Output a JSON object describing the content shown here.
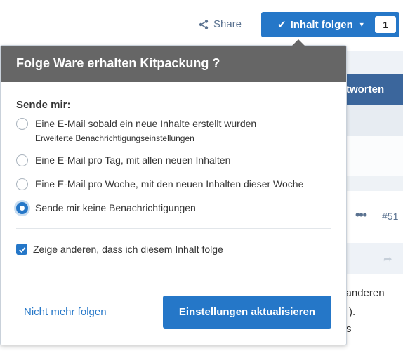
{
  "toolbar": {
    "share_label": "Share",
    "follow_label": "Inhalt folgen",
    "follow_count": "1"
  },
  "background": {
    "tab_label_partial": "tworten",
    "post_number": "#51",
    "text_line_1": "n anderen",
    "text_line_2": ").",
    "text_line_3": "s"
  },
  "popup": {
    "title": "Folge Ware erhalten Kitpackung ?",
    "send_label": "Sende mir:",
    "options": [
      {
        "label": "Eine E-Mail sobald ein neue Inhalte erstellt wurden",
        "sub": "Erweiterte Benachrichtigungseinstellungen",
        "selected": false
      },
      {
        "label": "Eine E-Mail pro Tag, mit allen neuen Inhalten",
        "selected": false
      },
      {
        "label": "Eine E-Mail pro Woche, mit den neuen Inhalten dieser Woche",
        "selected": false
      },
      {
        "label": "Sende mir keine Benachrichtigungen",
        "selected": true
      }
    ],
    "show_others_label": "Zeige anderen, dass ich diesem Inhalt folge",
    "show_others_checked": true,
    "unfollow_label": "Nicht mehr folgen",
    "update_label": "Einstellungen aktualisieren"
  },
  "colors": {
    "accent": "#2577c8",
    "header_bg": "#666666",
    "nav_blue": "#3b669c"
  },
  "icons": {
    "share": "share-icon",
    "follow": "checkmark-icon",
    "dropdown": "chevron-down-icon",
    "more": "ellipsis-icon",
    "reply": "reply-icon"
  }
}
